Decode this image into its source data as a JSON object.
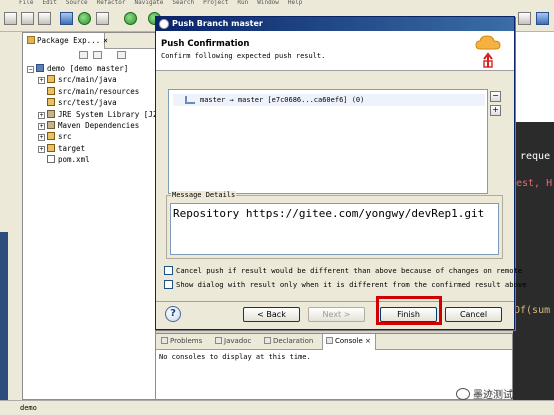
{
  "menu": [
    "File",
    "Edit",
    "Source",
    "Refactor",
    "Navigate",
    "Search",
    "Project",
    "Run",
    "Window",
    "Help"
  ],
  "explorer": {
    "tab_label": "Package Exp...",
    "close": "×",
    "tree": [
      {
        "label": "demo  [demo master]",
        "indent": 0,
        "expander": "−",
        "icon": "project-icon"
      },
      {
        "label": "src/main/java",
        "indent": 1,
        "expander": "+",
        "icon": "source-folder-icon"
      },
      {
        "label": "src/main/resources",
        "indent": 1,
        "expander": "",
        "icon": "source-folder-icon"
      },
      {
        "label": "src/test/java",
        "indent": 1,
        "expander": "",
        "icon": "source-folder-icon"
      },
      {
        "label": "JRE System Library [J2",
        "indent": 1,
        "expander": "+",
        "icon": "library-icon"
      },
      {
        "label": "Maven Dependencies",
        "indent": 1,
        "expander": "+",
        "icon": "library-icon"
      },
      {
        "label": "src",
        "indent": 1,
        "expander": "+",
        "icon": "folder-icon"
      },
      {
        "label": "target",
        "indent": 1,
        "expander": "+",
        "icon": "folder-icon"
      },
      {
        "label": "pom.xml",
        "indent": 1,
        "expander": "",
        "icon": "file-icon"
      }
    ]
  },
  "editor_snippets": {
    "line1": "reque",
    "line2": "est, H",
    "line3": "Of(sum"
  },
  "dialog": {
    "title": "Push Branch master",
    "heading": "Push Confirmation",
    "description": "Confirm following expected push result.",
    "result_row": "master → master [e7c0686...ca60ef6] (0)",
    "message_label": "Message Details",
    "message_text": "Repository https://gitee.com/yongwy/devRep1.git",
    "checkbox1": "Cancel push if result would be different than above because of changes on remote",
    "checkbox2": "Show dialog with result only when it is different from the confirmed result above",
    "buttons": {
      "back": "< Back",
      "next": "Next >",
      "finish": "Finish",
      "cancel": "Cancel"
    },
    "help": "?",
    "collapse_all": "−",
    "expand_all": "+"
  },
  "console": {
    "tabs": [
      "Problems",
      "Javadoc",
      "Declaration",
      "Console"
    ],
    "close": "×",
    "body": "No consoles to display at this time."
  },
  "statusbar": {
    "text": "demo"
  },
  "watermark": "墨迹测试",
  "colors": {
    "highlight": "#d00000",
    "title_bar": "#0a246a"
  }
}
